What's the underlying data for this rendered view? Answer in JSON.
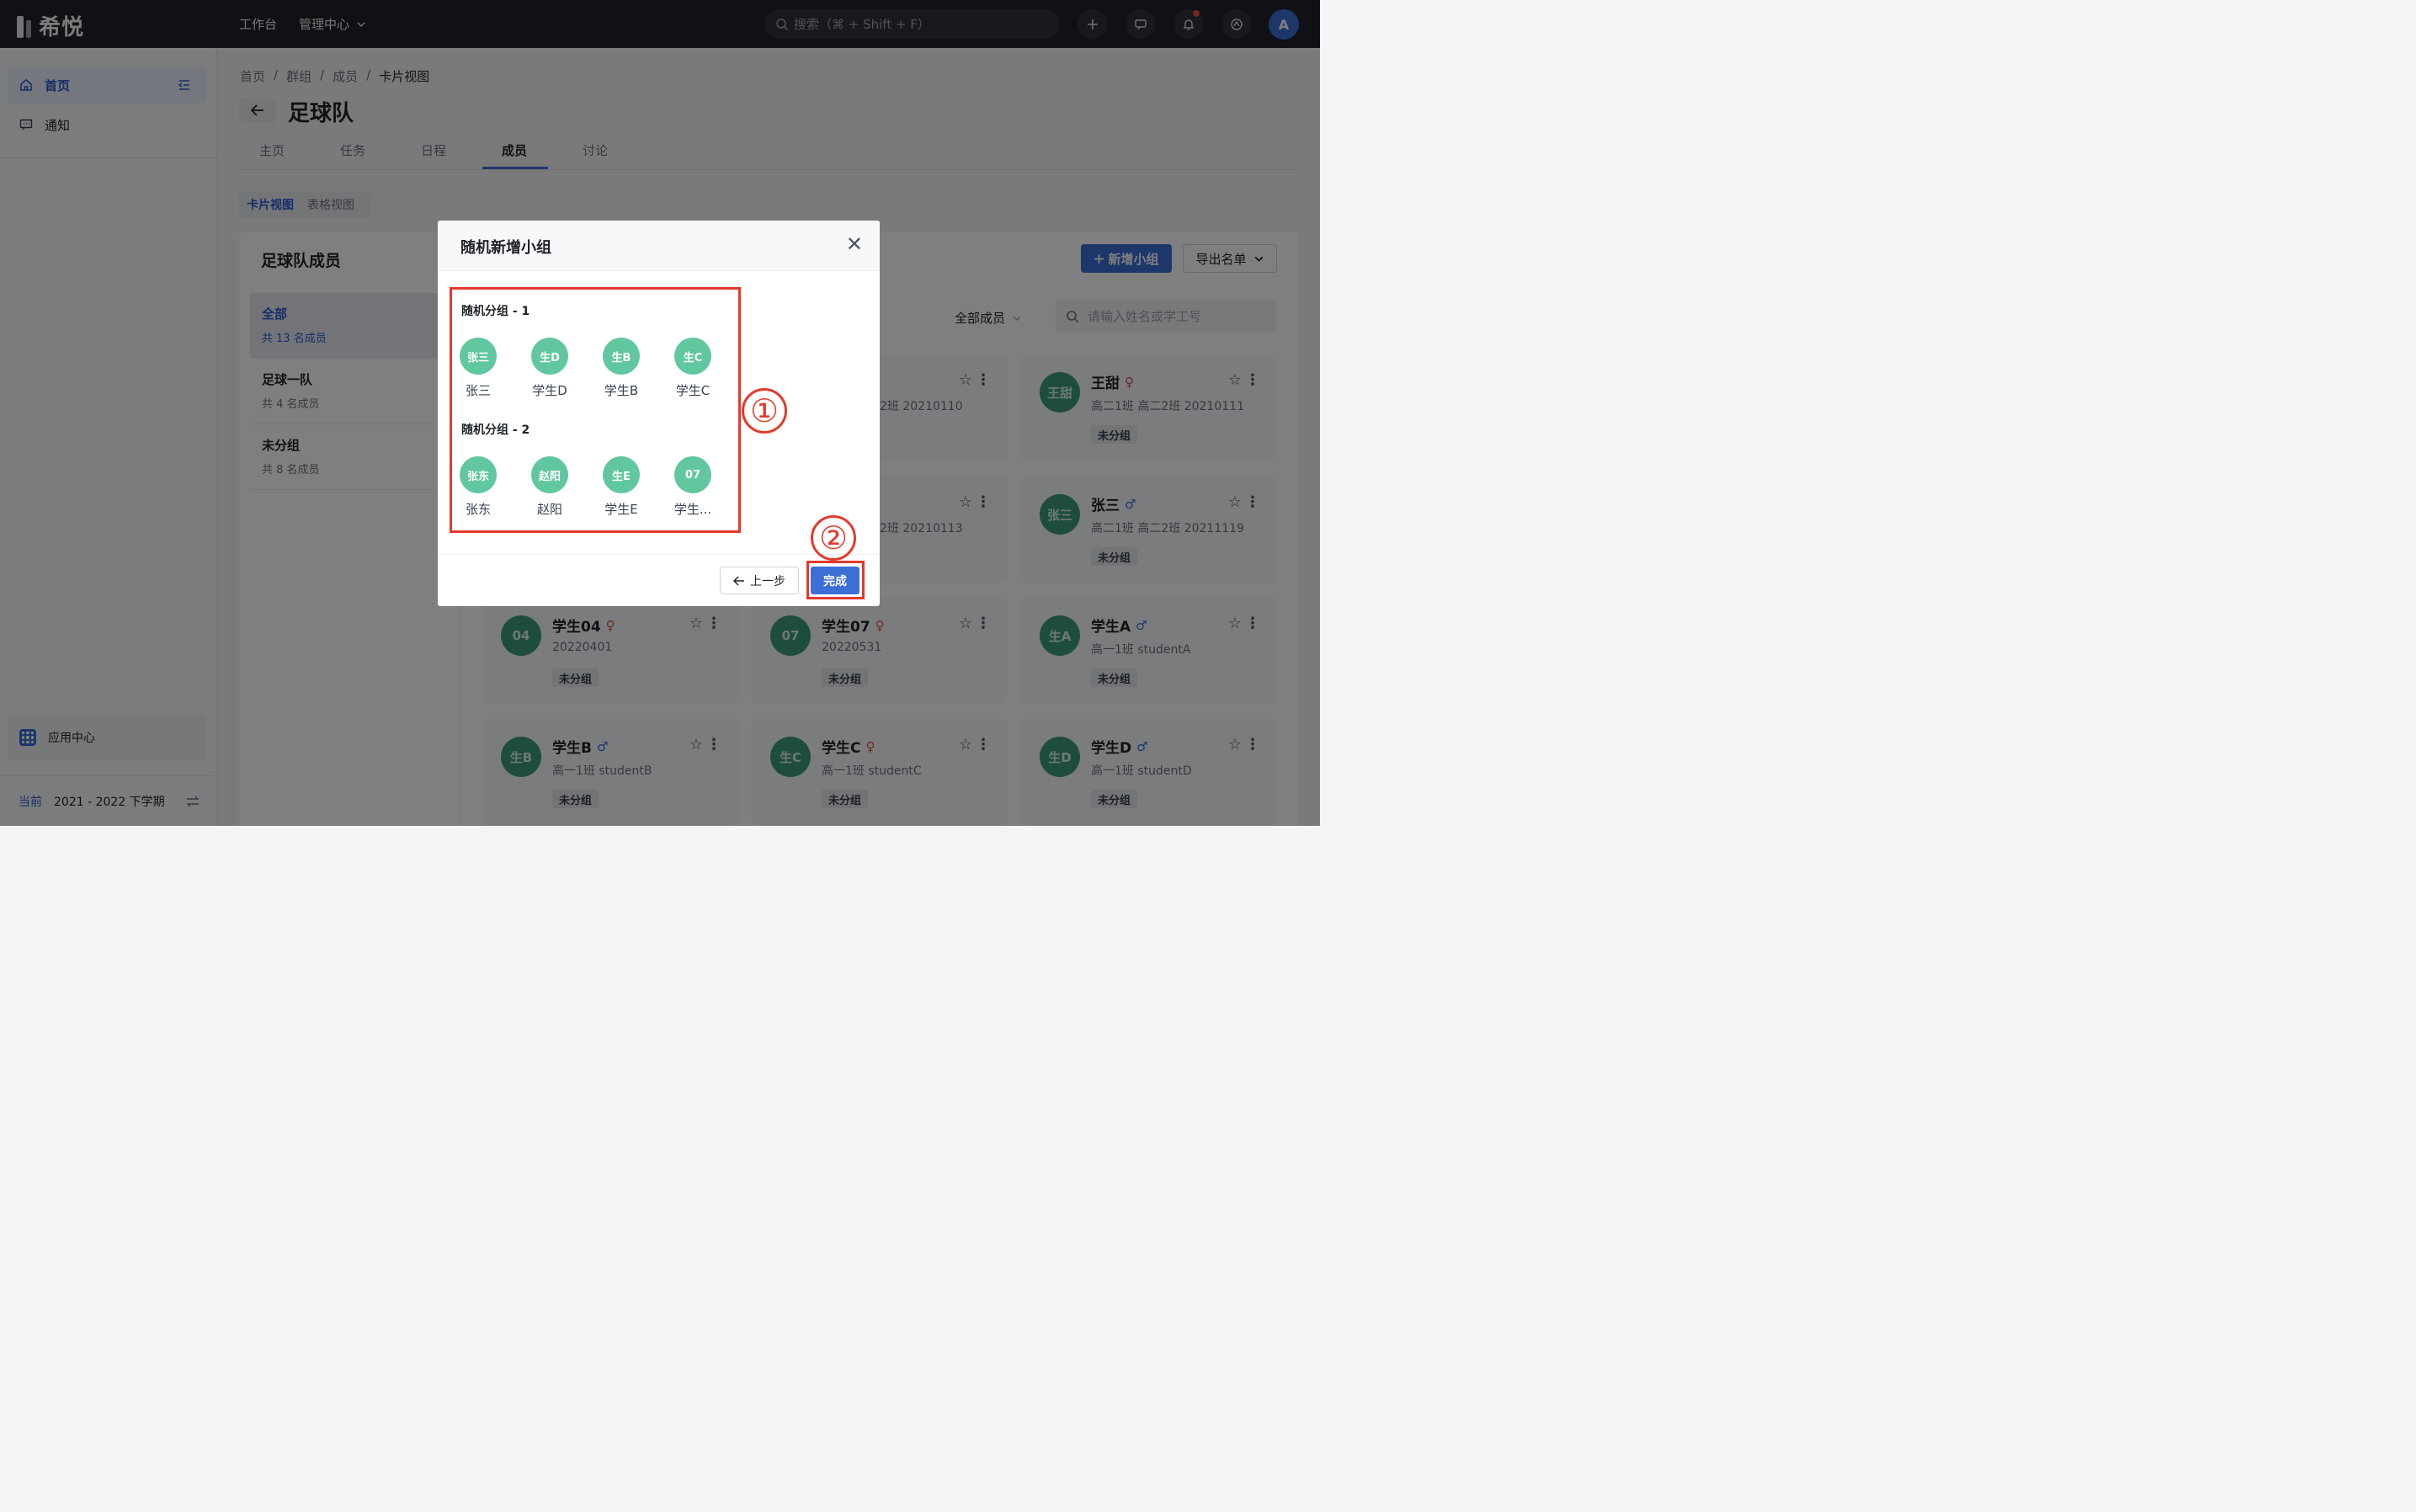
{
  "app": {
    "logo_text": "希悦",
    "user_initial": "A"
  },
  "topnav": {
    "workbench": "工作台",
    "admin": "管理中心"
  },
  "search": {
    "placeholder": "搜索（⌘ + Shift + F）"
  },
  "sidebar": {
    "items": [
      {
        "label": "首页"
      },
      {
        "label": "通知"
      }
    ],
    "app_center": "应用中心",
    "term_current": "当前",
    "term_value": "2021 - 2022 下学期"
  },
  "breadcrumb": [
    "首页",
    "群组",
    "成员",
    "卡片视图"
  ],
  "page": {
    "title": "足球队"
  },
  "tabs": [
    {
      "label": "主页"
    },
    {
      "label": "任务"
    },
    {
      "label": "日程"
    },
    {
      "label": "成员"
    },
    {
      "label": "讨论"
    }
  ],
  "views": {
    "card": "卡片视图",
    "table": "表格视图"
  },
  "panel": {
    "title": "足球队成员",
    "add_group": "新增小组",
    "export": "导出名单",
    "filter": "全部成员",
    "search_placeholder": "请输入姓名或学工号",
    "groups": [
      {
        "name": "全部",
        "count": "共 13 名成员"
      },
      {
        "name": "足球一队",
        "count": "共 4 名成员"
      },
      {
        "name": "未分组",
        "count": "共 8 名成员"
      }
    ]
  },
  "cards": [
    {
      "avatar": "",
      "name": "",
      "gender": "",
      "sub": "2班 20210110",
      "tag": ""
    },
    {
      "avatar": "王甜",
      "name": "王甜",
      "gender": "♀",
      "sub": "高二1班 高二2班 20210111",
      "tag": "未分组"
    },
    {
      "avatar": "",
      "name": "",
      "gender": "",
      "sub": "2班 20210113",
      "tag": ""
    },
    {
      "avatar": "张三",
      "name": "张三",
      "gender": "♂",
      "sub": "高二1班 高二2班 20211119",
      "tag": "未分组"
    },
    {
      "avatar": "04",
      "name": "学生04",
      "gender": "♀",
      "sub": "20220401",
      "tag": "未分组"
    },
    {
      "avatar": "07",
      "name": "学生07",
      "gender": "♀",
      "sub": "20220531",
      "tag": "未分组"
    },
    {
      "avatar": "生A",
      "name": "学生A",
      "gender": "♂",
      "sub": "高一1班 studentA",
      "tag": "未分组"
    },
    {
      "avatar": "生B",
      "name": "学生B",
      "gender": "♂",
      "sub": "高一1班 studentB",
      "tag": "未分组"
    },
    {
      "avatar": "生C",
      "name": "学生C",
      "gender": "♀",
      "sub": "高一1班 studentC",
      "tag": "未分组"
    },
    {
      "avatar": "生D",
      "name": "学生D",
      "gender": "♂",
      "sub": "高一1班 studentD",
      "tag": "未分组"
    }
  ],
  "modal": {
    "title": "随机新增小组",
    "groups": [
      {
        "title": "随机分组 - 1",
        "members": [
          {
            "avatar": "张三",
            "name": "张三"
          },
          {
            "avatar": "生D",
            "name": "学生D"
          },
          {
            "avatar": "生B",
            "name": "学生B"
          },
          {
            "avatar": "生C",
            "name": "学生C"
          }
        ]
      },
      {
        "title": "随机分组 - 2",
        "members": [
          {
            "avatar": "张东",
            "name": "张东"
          },
          {
            "avatar": "赵阳",
            "name": "赵阳"
          },
          {
            "avatar": "生E",
            "name": "学生E"
          },
          {
            "avatar": "07",
            "name": "学生..."
          }
        ]
      }
    ],
    "prev": "上一步",
    "done": "完成"
  },
  "annotations": {
    "one": "①",
    "two": "②",
    "color": "#e33a2c"
  },
  "colors": {
    "accent": "#3b6fd6",
    "avatar_green": "#61c79f",
    "topbar": "#1f2329"
  }
}
